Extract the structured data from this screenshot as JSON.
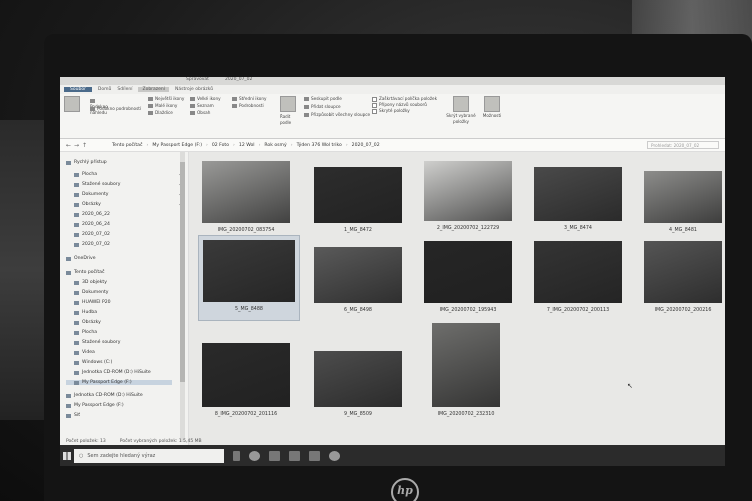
{
  "ribbon": {
    "tabs": [
      "Soubor",
      "Domů",
      "Sdílení",
      "Zobrazení",
      "Nástroje obrázků"
    ],
    "manage_tab": "Spravovat",
    "context_title": "2020_07_02",
    "pane_group": {
      "navpane_label": "Navigační podokno",
      "preview": "Podokno náhledu",
      "details": "Podokno podrobností",
      "label": "Podokna"
    },
    "layout_group": {
      "items": [
        "Největší ikony",
        "Velké ikony",
        "Střední ikony",
        "Malé ikony",
        "Seznam",
        "Podrobnosti",
        "Dlaždice",
        "Obsah"
      ],
      "label": "Rozložení"
    },
    "current_view": {
      "sort": "Řadit podle",
      "group_by": "Seskupit podle",
      "add_columns": "Přidat sloupce",
      "fit_columns": "Přizpůsobit všechny sloupce",
      "label": "Aktuální zobrazení"
    },
    "show_hide": {
      "checkboxes": [
        "Zaškrtávací políčka položek",
        "Přípony názvů souborů",
        "Skryté položky"
      ],
      "hide_selected": "Skrýt vybrané položky",
      "options": "Možnosti",
      "label": "Zobrazit či skrýt"
    }
  },
  "address": {
    "crumbs": [
      "Tento počítač",
      "My Passport Edge (F:)",
      "02 Foto",
      "12 Wol",
      "Rok osmý",
      "Týden 376 Wol triko",
      "2020_07_02"
    ],
    "search_placeholder": "Prohledat: 2020_07_02"
  },
  "navpane": {
    "items": [
      {
        "label": "Rychlý přístup",
        "pinned": false
      },
      {
        "label": "Plocha",
        "pinned": true
      },
      {
        "label": "Stažené soubory",
        "pinned": true
      },
      {
        "label": "Dokumenty",
        "pinned": true
      },
      {
        "label": "Obrázky",
        "pinned": true
      },
      {
        "label": "2020_06_22",
        "pinned": false
      },
      {
        "label": "2020_06_24",
        "pinned": false
      },
      {
        "label": "2020_07_02",
        "pinned": false
      },
      {
        "label": "2020_07_02",
        "pinned": false
      },
      {
        "label": "OneDrive",
        "pinned": false
      },
      {
        "label": "Tento počítač",
        "pinned": false
      },
      {
        "label": "3D objekty",
        "pinned": false
      },
      {
        "label": "Dokumenty",
        "pinned": false
      },
      {
        "label": "HUAWEI P20",
        "pinned": false
      },
      {
        "label": "Hudba",
        "pinned": false
      },
      {
        "label": "Obrázky",
        "pinned": false
      },
      {
        "label": "Plocha",
        "pinned": false
      },
      {
        "label": "Stažené soubory",
        "pinned": false
      },
      {
        "label": "Videa",
        "pinned": false
      },
      {
        "label": "Windows (C:)",
        "pinned": false
      },
      {
        "label": "Jednotka CD-ROM (D:) HiSuite",
        "pinned": false
      },
      {
        "label": "My Passport Edge (F:)",
        "pinned": false,
        "selected": true
      },
      {
        "label": "Jednotka CD-ROM (D:) HiSuite",
        "pinned": false
      },
      {
        "label": "My Passport Edge (F:)",
        "pinned": false
      },
      {
        "label": "Síť",
        "pinned": false
      }
    ]
  },
  "files": [
    {
      "name": "IMG_20200702_083754",
      "tone": "#9a9a98"
    },
    {
      "name": "1_MG_8472",
      "tone": "#2d2d2d"
    },
    {
      "name": "2_IMG_20200702_122729",
      "tone": "#cfcfcd"
    },
    {
      "name": "3_MG_8474",
      "tone": "#4a4a4a"
    },
    {
      "name": "4_MG_8481",
      "tone": "#8d8d8b"
    },
    {
      "name": "5_MG_8488",
      "tone": "#3a3a3a",
      "selected": true
    },
    {
      "name": "6_MG_8498",
      "tone": "#5a5a5a"
    },
    {
      "name": "IMG_20200702_195943",
      "tone": "#262626"
    },
    {
      "name": "7_IMG_20200702_200113",
      "tone": "#343434"
    },
    {
      "name": "IMG_20200702_200216",
      "tone": "#555555"
    },
    {
      "name": "8_IMG_20200702_201116",
      "tone": "#2a2a2a"
    },
    {
      "name": "9_MG_8509",
      "tone": "#4d4d4d"
    },
    {
      "name": "IMG_20200702_232310",
      "tone": "#6e6e6c"
    }
  ],
  "status": {
    "items_count": "Počet položek: 13",
    "selected": "Počet vybraných položek: 1  5,45 MB"
  },
  "taskbar": {
    "search_placeholder": "Sem zadejte hledaný výraz"
  },
  "brand": {
    "logo": "hp"
  }
}
